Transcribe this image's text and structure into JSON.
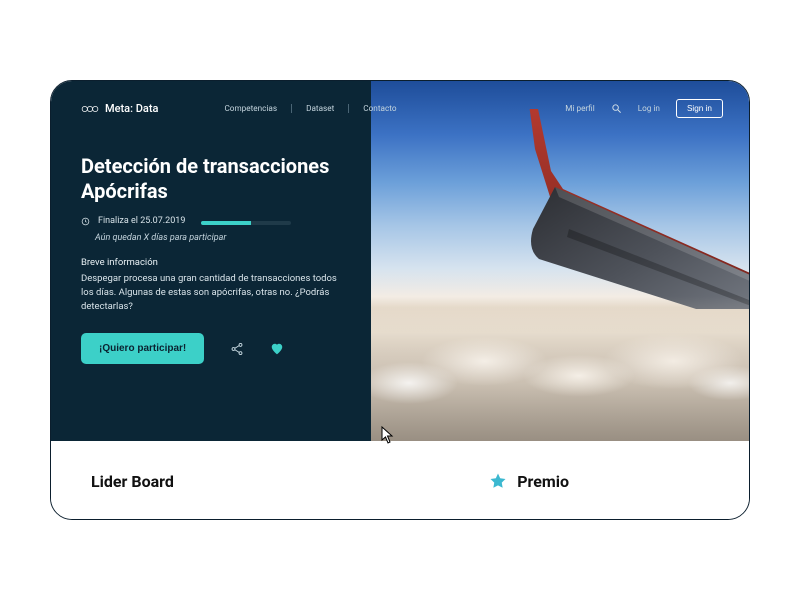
{
  "brand": "Meta: Data",
  "nav": {
    "competencias": "Competencias",
    "dataset": "Dataset",
    "contacto": "Contacto",
    "miperfil": "Mi perfil",
    "login": "Log in",
    "signin": "Sign in"
  },
  "hero": {
    "title": "Detección de transacciones Apócrifas",
    "deadline": "Finaliza el 25.07.2019",
    "remaining": "Aún quedan X días para participar",
    "progress_pct": 55,
    "info_label": "Breve información",
    "description": "Despegar procesa una gran cantidad de transacciones todos los días. Algunas de estas son apócrifas, otras no. ¿Podrás detectarlas?",
    "cta": "¡Quiero participar!"
  },
  "tabs": {
    "leaderboard": "Lider Board",
    "premio": "Premio"
  },
  "colors": {
    "accent": "#3cd0c8",
    "bg_dark": "#0b2636"
  }
}
